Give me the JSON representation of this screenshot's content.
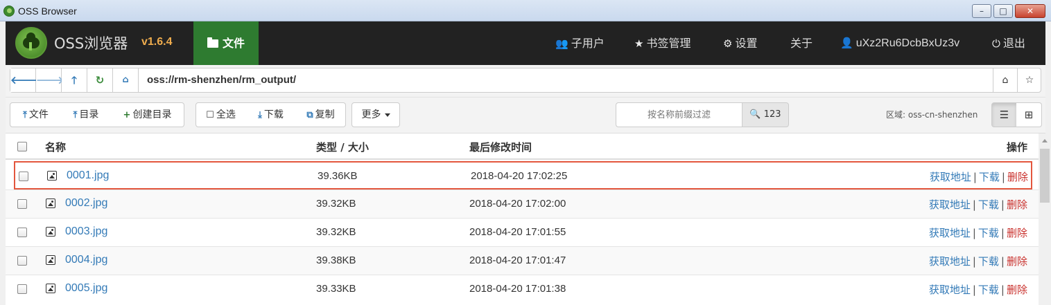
{
  "window": {
    "title": "OSS Browser",
    "controls": [
      "–",
      "□",
      "✕"
    ]
  },
  "nav": {
    "brand": "OSS浏览器",
    "version": "v1.6.4",
    "files_label": "文件",
    "subusers_label": "子用户",
    "bookmarks_label": "书签管理",
    "settings_label": "设置",
    "about_label": "关于",
    "user_label": "uXz2Ru6DcbBxUz3v",
    "logout_label": "退出"
  },
  "address": {
    "path": "oss://rm-shenzhen/rm_output/"
  },
  "toolbar": {
    "upload_file": "文件",
    "upload_dir": "目录",
    "create_dir": "创建目录",
    "select_all": "全选",
    "download": "下载",
    "copy": "复制",
    "more": "更多",
    "filter_placeholder": "按名称前缀过滤",
    "filter_count": "123",
    "region": "区域: oss-cn-shenzhen"
  },
  "table": {
    "headers": {
      "name": "名称",
      "type_size": "类型 / 大小",
      "modified": "最后修改时间",
      "actions": "操作"
    },
    "action_labels": {
      "get_url": "获取地址",
      "download": "下载",
      "delete": "删除",
      "sep": "|"
    },
    "rows": [
      {
        "name": "0001.jpg",
        "size": "39.36KB",
        "modified": "2018-04-20 17:02:25"
      },
      {
        "name": "0002.jpg",
        "size": "39.32KB",
        "modified": "2018-04-20 17:02:00"
      },
      {
        "name": "0003.jpg",
        "size": "39.32KB",
        "modified": "2018-04-20 17:01:55"
      },
      {
        "name": "0004.jpg",
        "size": "39.38KB",
        "modified": "2018-04-20 17:01:47"
      },
      {
        "name": "0005.jpg",
        "size": "39.33KB",
        "modified": "2018-04-20 17:01:38"
      }
    ]
  },
  "colors": {
    "accent": "#337ab7",
    "nav_bg": "#222222",
    "active_tab": "#2e7b30",
    "version": "#f0ad4e",
    "delete": "#c9302c",
    "selection": "#e3563d"
  }
}
